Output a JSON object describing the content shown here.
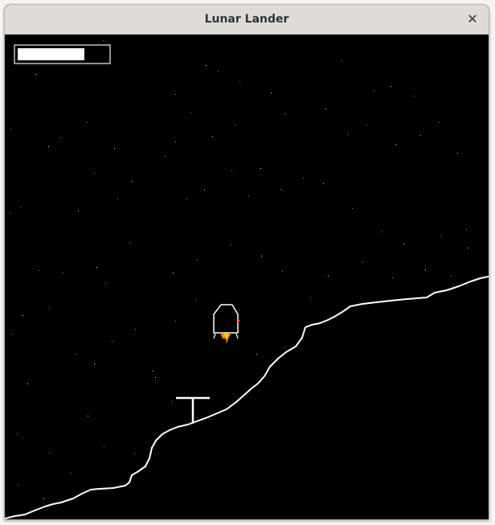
{
  "window": {
    "title": "Lunar Lander",
    "close_icon": "close-icon",
    "close_glyph": "✕"
  },
  "hud": {
    "fuel_fraction": 0.75,
    "bar_color": "#ffffff",
    "border_color": "#bfbfbf"
  },
  "colors": {
    "sky": "#000000",
    "terrain": "#ffffff",
    "stars": "#ffffff",
    "lander": "#ffffff",
    "flame_outer": "#ff8c00",
    "flame_inner": "#ffd000",
    "side_thruster": "#ff3b3b"
  },
  "lander": {
    "main_thruster": "on",
    "side_thruster": "right"
  },
  "landing_pad": {
    "icon": "landing-pad-icon"
  }
}
